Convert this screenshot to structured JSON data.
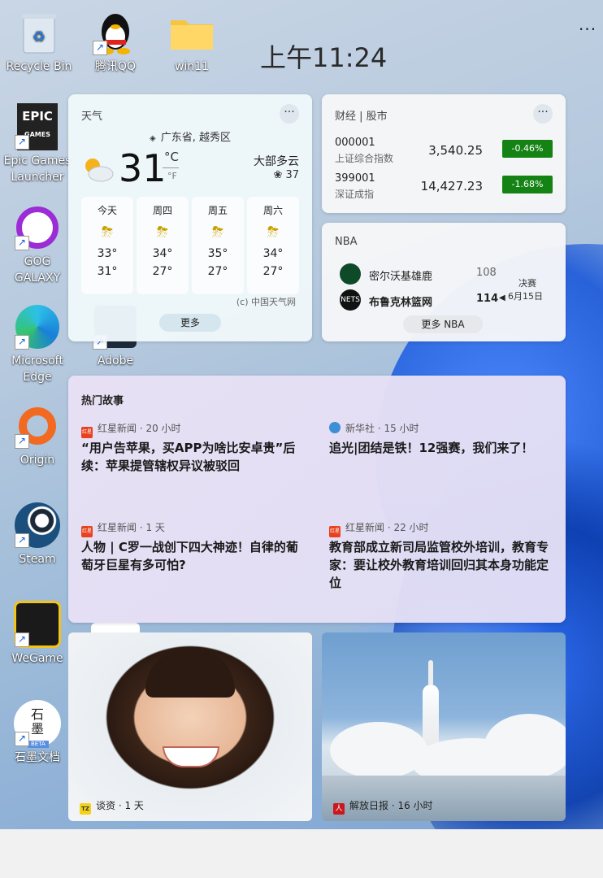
{
  "desktop": {
    "clock": "上午11:24",
    "icons": [
      {
        "label": "Recycle Bin"
      },
      {
        "label": "腾讯QQ"
      },
      {
        "label": "win11"
      },
      {
        "label": "Epic Games\nLauncher"
      },
      {
        "label": "GOG\nGALAXY"
      },
      {
        "label": "Microsoft\nEdge"
      },
      {
        "label": "Adobe"
      },
      {
        "label": "Origin"
      },
      {
        "label": "Steam"
      },
      {
        "label": "WeGame"
      },
      {
        "label": "石墨文档"
      }
    ],
    "icon_text": {
      "epic": "EPIC",
      "epic_sub": "GAMES",
      "shimo_top": "石",
      "shimo_bottom": "墨",
      "shimo_beta": "BETA"
    }
  },
  "weather": {
    "title": "天气",
    "location": "广东省, 越秀区",
    "temperature": "31",
    "unit_c": "°C",
    "unit_f": "°F",
    "condition": "大部多云",
    "aqi": "37",
    "forecast": [
      {
        "day": "今天",
        "high": "33°",
        "low": "31°"
      },
      {
        "day": "周四",
        "high": "34°",
        "low": "27°"
      },
      {
        "day": "周五",
        "high": "35°",
        "low": "27°"
      },
      {
        "day": "周六",
        "high": "34°",
        "low": "27°"
      }
    ],
    "source": "(c) 中国天气网",
    "more": "更多"
  },
  "finance": {
    "title": "财经 | 股市",
    "rows": [
      {
        "code": "000001",
        "name": "上证综合指数",
        "value": "3,540.25",
        "change": "-0.46%"
      },
      {
        "code": "399001",
        "name": "深证成指",
        "value": "14,427.23",
        "change": "-1.68%"
      }
    ],
    "change_color": "#148314"
  },
  "nba": {
    "title": "NBA",
    "teams": [
      {
        "name": "密尔沃基雄鹿",
        "score": "108"
      },
      {
        "name": "布鲁克林篮网",
        "score": "114"
      }
    ],
    "team_logos": [
      "",
      "NETS"
    ],
    "status": "决赛",
    "date": "6月15日",
    "more": "更多 NBA"
  },
  "news": {
    "header": "热门故事",
    "articles": [
      {
        "source": "红星新闻 · 20 小时",
        "title": "“用户告苹果，买APP为啥比安卓贵”后续：苹果提管辖权异议被驳回"
      },
      {
        "source": "新华社 · 15 小时",
        "title": "追光|团结是铁！12强赛，我们来了！"
      },
      {
        "source": "红星新闻 · 1 天",
        "title": "人物 | C罗一战创下四大神迹！自律的葡萄牙巨星有多可怕?"
      },
      {
        "source": "红星新闻 · 22 小时",
        "title": "教育部成立新司局监管校外培训，教育专家：要让校外教育培训回归其本身功能定位"
      }
    ],
    "source_logos": [
      "红星",
      "",
      "红星",
      "红星"
    ]
  },
  "photos": [
    {
      "source": "谈资 · 1 天",
      "logo": "TZ"
    },
    {
      "source": "解放日报 · 16 小时",
      "logo": "人"
    }
  ],
  "colors": {
    "accent": "#1a57d9",
    "finance_negative": "#148314"
  }
}
